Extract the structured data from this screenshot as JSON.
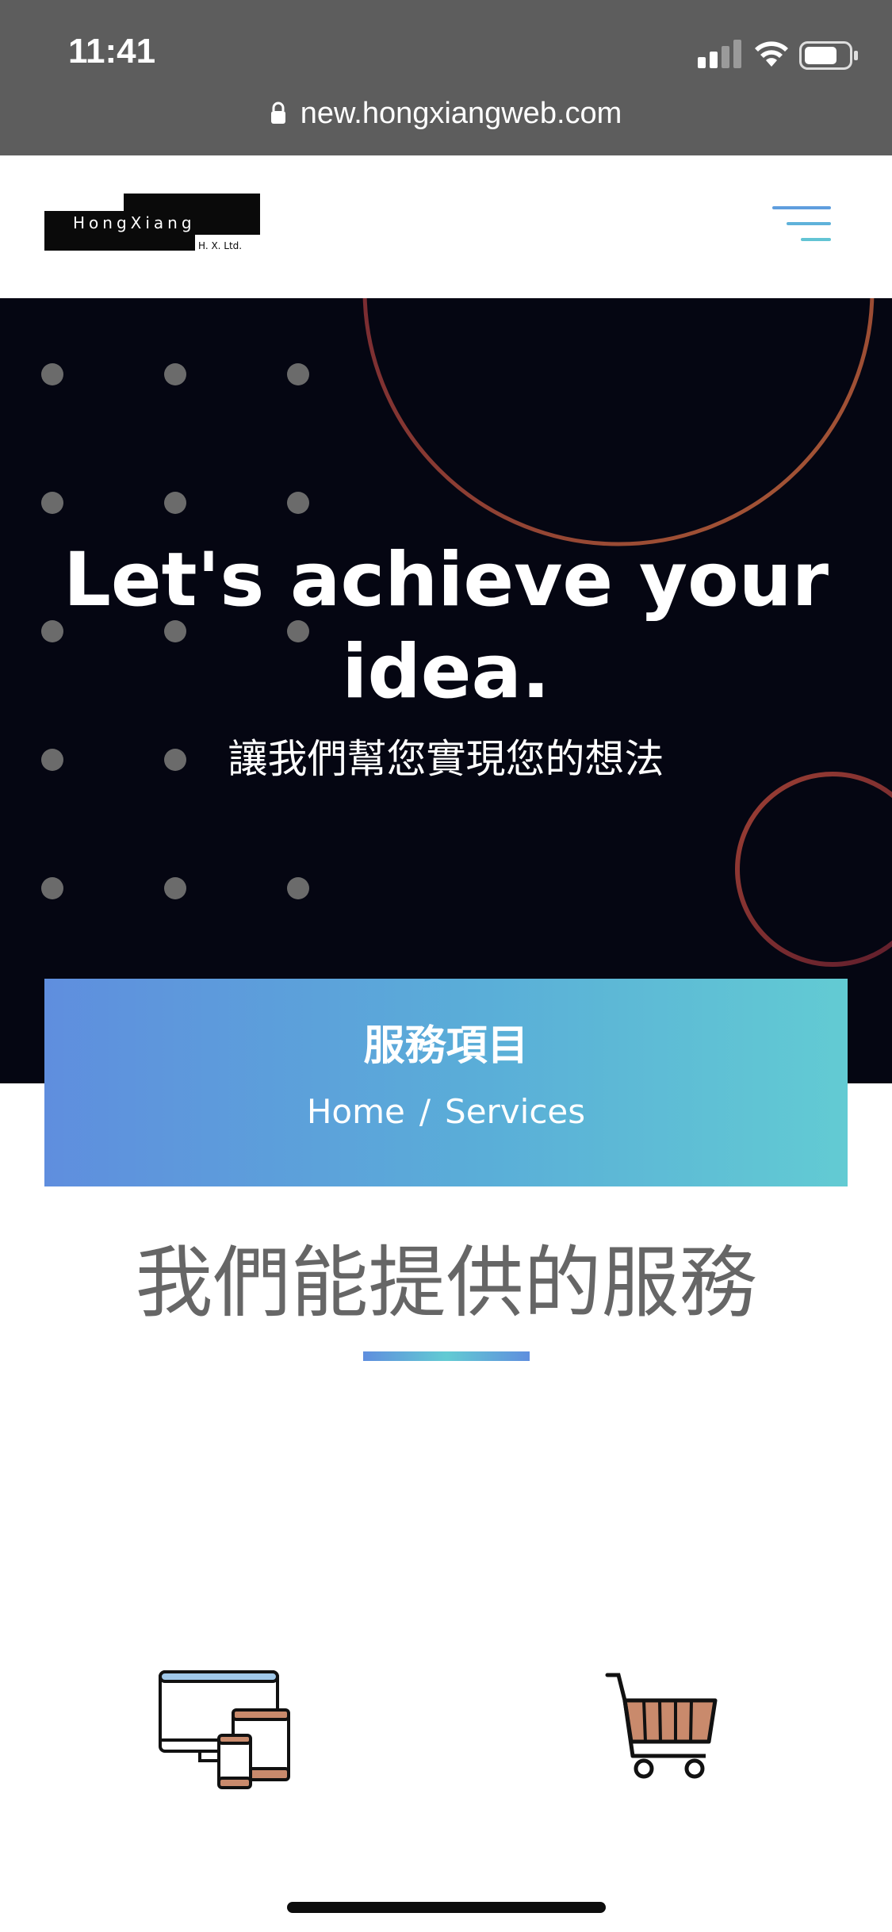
{
  "status_bar": {
    "time": "11:41",
    "url": "new.hongxiangweb.com"
  },
  "header": {
    "logo": {
      "name": "HongXiang",
      "subtitle": "H. X. Ltd."
    },
    "menu_icon": "hamburger-menu-icon"
  },
  "hero": {
    "title": "Let's achieve your idea.",
    "subtitle": "讓我們幫您實現您的想法"
  },
  "banner": {
    "title": "服務項目",
    "breadcrumb": {
      "home": "Home",
      "separator": "/",
      "current": "Services"
    }
  },
  "section": {
    "heading": "我們能提供的服務"
  },
  "services_icons": [
    "devices-icon",
    "shopping-cart-icon"
  ],
  "colors": {
    "status_bar": "#5d5d5d",
    "hero_bg": "#050612",
    "gradient_start": "#5f8ede",
    "gradient_end": "#62cbd3",
    "heading_text": "#666666",
    "icon_accent": "#c98a6c"
  }
}
